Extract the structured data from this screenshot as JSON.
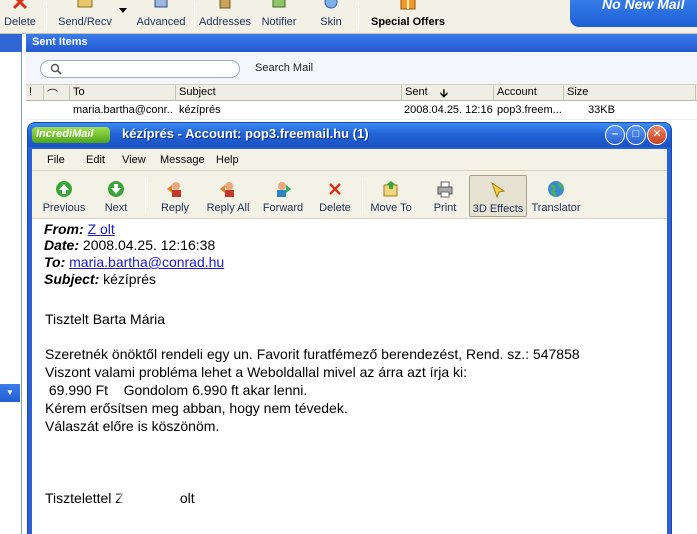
{
  "toolbar": {
    "delete": "Delete",
    "send_recv": "Send/Recv",
    "advanced": "Advanced",
    "addresses": "Addresses",
    "notifier": "Notifier",
    "skin": "Skin",
    "special_offers": "Special Offers",
    "banner": "No New Mail"
  },
  "sent_items": {
    "title": "Sent Items",
    "search_label": "Search Mail",
    "search_placeholder": "",
    "columns": [
      "To",
      "Subject",
      "Sent",
      "Account",
      "Size"
    ],
    "row": {
      "to": "maria.bartha@conr...",
      "subject": "kézíprés",
      "sent": "2008.04.25. 12:16",
      "account": "pop3.freem...",
      "size": "33KB"
    }
  },
  "message_window": {
    "logo": "IncrediMail",
    "title": "kézíprés - Account: pop3.freemail.hu (1)",
    "menu": [
      "File",
      "Edit",
      "View",
      "Message",
      "Help"
    ],
    "buttons": {
      "previous": "Previous",
      "next": "Next",
      "reply": "Reply",
      "reply_all": "Reply All",
      "forward": "Forward",
      "delete": "Delete",
      "move_to": "Move To",
      "print": "Print",
      "effects": "3D Effects",
      "translator": "Translator"
    }
  },
  "message": {
    "from_label": "From:",
    "from_value": "Z           olt",
    "date_label": "Date:",
    "date_value": "2008.04.25. 12:16:38",
    "to_label": "To:",
    "to_value": "maria.bartha@conrad.hu",
    "subject_label": "Subject:",
    "subject_value": "kézíprés",
    "greeting": "Tisztelt Barta Mária",
    "line1": "Szeretnék önöktől rendeli egy un. Favorit furatfémező berendezést, Rend. sz.: 547858",
    "line2": "Viszont valami probléma lehet a Weboldallal mivel az árra azt írja ki:",
    "line3": " 69.990 Ft    Gondolom 6.990 ft akar lenni.",
    "line4": "Kérem erősítsen meg abban, hogy nem tévedek.",
    "line5": "Válaszát előre is köszönöm.",
    "signature_prefix": "Tisztelettel Z",
    "signature_suffix": "olt"
  },
  "colors": {
    "xp_blue": "#2a5fd6",
    "toolbar_beige": "#f4f1e6",
    "close_red": "#c8401b",
    "link_blue": "#1a1ad2"
  }
}
